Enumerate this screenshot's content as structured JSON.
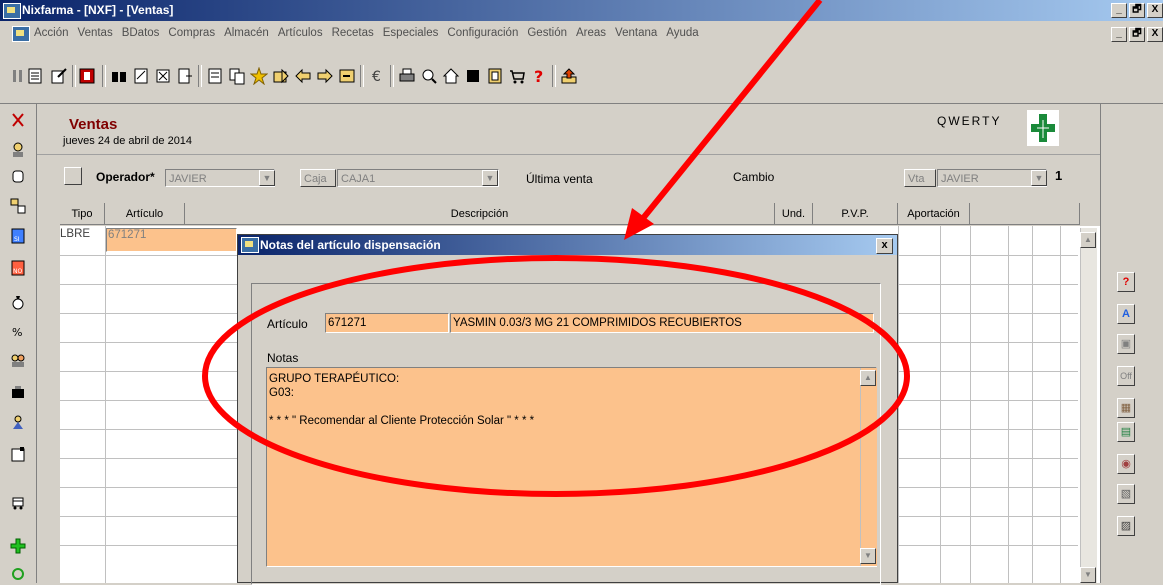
{
  "window": {
    "title": "Nixfarma - [NXF] - [Ventas]",
    "controls": [
      "_",
      "🗗",
      "X"
    ]
  },
  "menu": {
    "items": [
      "Acción",
      "Ventas",
      "BDatos",
      "Compras",
      "Almacén",
      "Artículos",
      "Recetas",
      "Especiales",
      "Configuración",
      "Gestión",
      "Areas",
      "Ventana",
      "Ayuda"
    ]
  },
  "ventas": {
    "title": "Ventas",
    "date": "jueves 24 de abril de 2014",
    "qwerty": "QWERTY",
    "operador_label": "Operador*",
    "operador_value": "JAVIER",
    "caja_label": "Caja",
    "caja_value": "CAJA1",
    "ultima_venta_label": "Última venta",
    "cambio_label": "Cambio",
    "vta_label": "Vta",
    "vta_value": "JAVIER",
    "vta_number": "1"
  },
  "grid": {
    "columns": [
      "Tipo",
      "Artículo",
      "Descripción",
      "Und.",
      "P.V.P.",
      "Aportación"
    ],
    "rows": [
      {
        "tipo": "LBRE",
        "articulo": "671271"
      }
    ]
  },
  "dialog": {
    "title": "Notas del artículo dispensación",
    "close": "x",
    "articulo_label": "Artículo",
    "articulo_code": "671271",
    "articulo_desc": "YASMIN 0.03/3 MG 21 COMPRIMIDOS RECUBIERTOS",
    "notas_label": "Notas",
    "notas_lines": [
      "GRUPO TERAPÉUTICO:",
      "G03:",
      "",
      "* * * \" Recomendar al Cliente Protección Solar \" * * *"
    ]
  },
  "right_panel": {
    "off_label": "Off"
  },
  "colors": {
    "titlebar_start": "#0a246a",
    "titlebar_end": "#a6caf0",
    "field_highlight": "#fcc28c",
    "ventas_title": "#800000",
    "annotation": "#ff0000"
  }
}
